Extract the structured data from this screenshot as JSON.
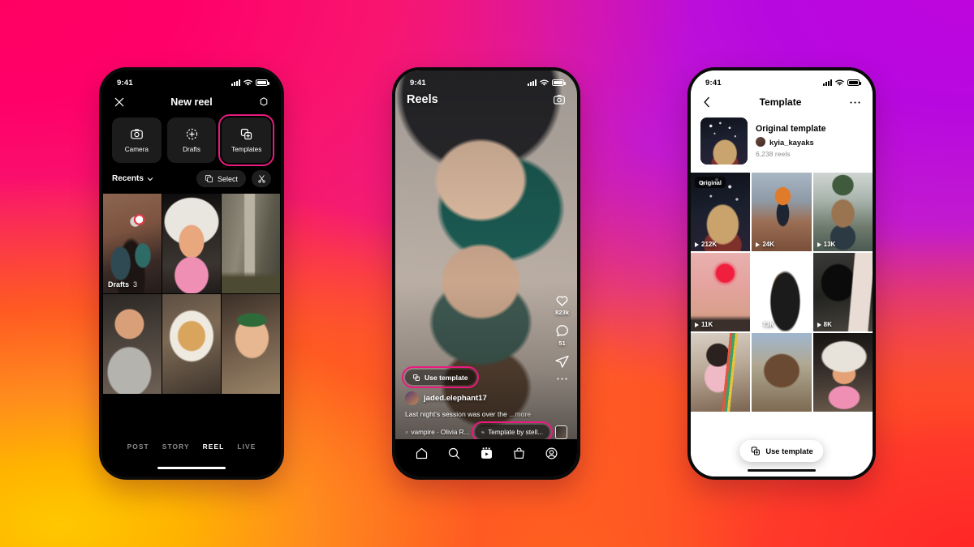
{
  "background": {
    "pink": "#FF0062",
    "purple": "#BE05DE",
    "orange": "#FF6A22",
    "yellow": "#FFC000",
    "red": "#FF2727"
  },
  "accent": {
    "highlight": "#EA1A7F"
  },
  "phone1": {
    "status": {
      "time": "9:41"
    },
    "header": {
      "title": "New reel",
      "close_icon": "close-icon",
      "settings_icon": "settings-icon"
    },
    "modes": [
      {
        "label": "Camera",
        "icon": "camera-icon",
        "highlighted": false
      },
      {
        "label": "Drafts",
        "icon": "drafts-plus-icon",
        "highlighted": false
      },
      {
        "label": "Templates",
        "icon": "templates-icon",
        "highlighted": true
      }
    ],
    "gallery_bar": {
      "source": "Recents",
      "select_label": "Select",
      "select_icon": "multi-select-icon",
      "cut_icon": "cut-icon",
      "chevron": "chevron-down-icon"
    },
    "drafts_overlay": {
      "label": "Drafts",
      "count": "3"
    },
    "tabs": [
      {
        "label": "POST",
        "active": false
      },
      {
        "label": "STORY",
        "active": false
      },
      {
        "label": "REEL",
        "active": true
      },
      {
        "label": "LIVE",
        "active": false
      }
    ]
  },
  "phone2": {
    "status": {
      "time": "9:41"
    },
    "header": {
      "title": "Reels",
      "camera_icon": "camera-icon"
    },
    "actions": [
      {
        "icon": "heart-icon",
        "count": "823k"
      },
      {
        "icon": "comment-icon",
        "count": "51"
      },
      {
        "icon": "share-icon",
        "count": ""
      },
      {
        "icon": "more-icon",
        "count": ""
      }
    ],
    "use_template": {
      "label": "Use template",
      "icon": "templates-icon"
    },
    "username": "jaded.elephant17",
    "caption": "Last night's session was over the ",
    "caption_more": "...more",
    "audio": "vampire · Olivia R...",
    "audio_icon": "music-note-icon",
    "template_chip": {
      "label": "Template by stell...",
      "icon": "templates-icon"
    },
    "nav": [
      {
        "icon": "home-icon",
        "active": false
      },
      {
        "icon": "search-icon",
        "active": false
      },
      {
        "icon": "reels-icon",
        "active": true
      },
      {
        "icon": "shop-icon",
        "active": false
      },
      {
        "icon": "profile-icon",
        "active": false
      }
    ]
  },
  "phone3": {
    "status": {
      "time": "9:41"
    },
    "header": {
      "title": "Template",
      "back_icon": "back-chevron-icon",
      "more_icon": "more-icon"
    },
    "template": {
      "name": "Original template",
      "author": "kyia_kayaks",
      "reels_count": "6,238 reels"
    },
    "grid": [
      {
        "views": "212K",
        "badge": "Original"
      },
      {
        "views": "24K",
        "badge": ""
      },
      {
        "views": "13K",
        "badge": ""
      },
      {
        "views": "11K",
        "badge": ""
      },
      {
        "views": "73K",
        "badge": ""
      },
      {
        "views": "8K",
        "badge": ""
      },
      {
        "views": "",
        "badge": ""
      },
      {
        "views": "",
        "badge": ""
      },
      {
        "views": "",
        "badge": ""
      }
    ],
    "fab": {
      "label": "Use template",
      "icon": "templates-plus-icon"
    }
  }
}
